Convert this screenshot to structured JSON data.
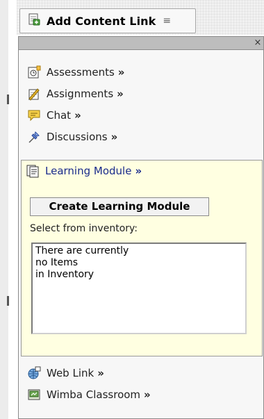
{
  "toolbar": {
    "add_content_link_label": "Add Content Link"
  },
  "panel": {
    "close_label": "×",
    "items": [
      {
        "label": "Assessments",
        "icon": "assessments-icon"
      },
      {
        "label": "Assignments",
        "icon": "assignments-icon"
      },
      {
        "label": "Chat",
        "icon": "chat-icon"
      },
      {
        "label": "Discussions",
        "icon": "discussions-icon"
      }
    ],
    "raquo": "»",
    "learning_module": {
      "label": "Learning Module",
      "icon": "learning-module-icon",
      "create_button_label": "Create Learning Module",
      "select_label": "Select from inventory:",
      "inventory_text": "There are currently\nno Items\nin Inventory"
    },
    "bottom_items": [
      {
        "label": "Web Link",
        "icon": "web-link-icon"
      },
      {
        "label": "Wimba Classroom",
        "icon": "wimba-classroom-icon"
      }
    ]
  },
  "colors": {
    "learning_module_background": "#ffffe1",
    "learning_module_link": "#1a2b8c",
    "panel_header": "#bdbdbd"
  }
}
